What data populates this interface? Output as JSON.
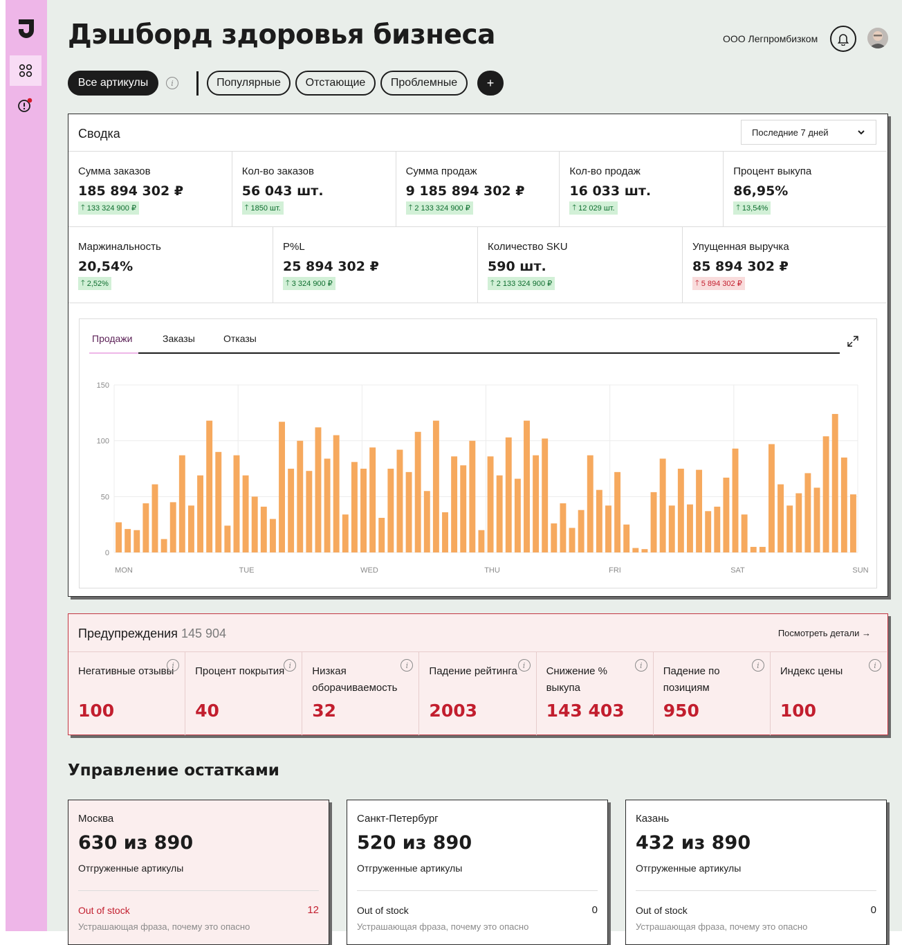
{
  "page_title": "Дэшборд здоровья бизнеса",
  "company_name": "ООО Легпромбизком",
  "filters": [
    {
      "label": "Все артикулы",
      "active": true
    },
    {
      "label": "Популярные",
      "active": false
    },
    {
      "label": "Отстающие",
      "active": false
    },
    {
      "label": "Проблемные",
      "active": false
    }
  ],
  "add_filter_label": "+",
  "summary": {
    "title": "Сводка",
    "period_selected": "Последние 7 дней",
    "row1": [
      {
        "label": "Сумма заказов",
        "value": "185 894 302 ₽",
        "delta": "133 324 900 ₽",
        "trend": "up"
      },
      {
        "label": "Кол-во заказов",
        "value": "56 043 шт.",
        "delta": "1850 шт.",
        "trend": "up"
      },
      {
        "label": "Сумма продаж",
        "value": "9 185 894 302 ₽",
        "delta": "2 133 324 900 ₽",
        "trend": "up"
      },
      {
        "label": "Кол-во продаж",
        "value": "16 033 шт.",
        "delta": "12 029 шт.",
        "trend": "up"
      },
      {
        "label": "Процент выкупа",
        "value": "86,95%",
        "delta": "13,54%",
        "trend": "up"
      }
    ],
    "row2": [
      {
        "label": "Маржинальность",
        "value": "20,54%",
        "delta": "2,52%",
        "trend": "up"
      },
      {
        "label": "P%L",
        "value": "25 894 302 ₽",
        "delta": "3 324 900 ₽",
        "trend": "up"
      },
      {
        "label": "Количество SKU",
        "value": "590 шт.",
        "delta": "2 133 324 900 ₽",
        "trend": "up"
      },
      {
        "label": "Упущенная выручка",
        "value": "85 894 302 ₽",
        "delta": "5 894 302 ₽",
        "trend": "down"
      }
    ]
  },
  "chart_tabs": [
    {
      "label": "Продажи",
      "active": true
    },
    {
      "label": "Заказы",
      "active": false
    },
    {
      "label": "Отказы",
      "active": false
    }
  ],
  "chart_data": {
    "type": "bar",
    "title": "",
    "xlabel": "",
    "ylabel": "",
    "ylim": [
      0,
      150
    ],
    "y_ticks": [
      0,
      50,
      100,
      150
    ],
    "x_day_labels": [
      "MON",
      "TUE",
      "WED",
      "THU",
      "FRI",
      "SAT",
      "SUN"
    ],
    "bar_color": "#f6a95e",
    "grid": true,
    "values": [
      27,
      21,
      20,
      44,
      61,
      12,
      45,
      87,
      42,
      69,
      118,
      90,
      24,
      87,
      69,
      50,
      41,
      30,
      117,
      75,
      100,
      73,
      112,
      84,
      105,
      34,
      81,
      75,
      94,
      31,
      75,
      92,
      72,
      108,
      55,
      118,
      36,
      86,
      78,
      100,
      20,
      86,
      69,
      103,
      66,
      118,
      87,
      102,
      26,
      44,
      22,
      38,
      87,
      56,
      42,
      72,
      25,
      4,
      3,
      54,
      84,
      42,
      75,
      43,
      74,
      37,
      41,
      67,
      93,
      34,
      5,
      5,
      97,
      61,
      42,
      53,
      71,
      58,
      104,
      124,
      85,
      52
    ]
  },
  "alerts": {
    "title": "Предупреждения",
    "count": "145 904",
    "details_link": "Посмотреть детали →",
    "items": [
      {
        "label": "Негативные отзывы",
        "value": "100"
      },
      {
        "label": "Процент покрытия",
        "value": "40"
      },
      {
        "label": "Низкая оборачиваемость",
        "value": "32"
      },
      {
        "label": "Падение рейтинга",
        "value": "2003"
      },
      {
        "label": "Снижение % выкупа",
        "value": "143 403"
      },
      {
        "label": "Падение по позициям",
        "value": "950"
      },
      {
        "label": "Индекс цены",
        "value": "100"
      }
    ]
  },
  "stock": {
    "title": "Управление остатками",
    "warehouses": [
      {
        "city": "Москва",
        "value": "630 из 890",
        "sub": "Отгруженные артикулы",
        "oos_label": "Out of stock",
        "oos_count": "12",
        "desc": "Устрашающая фраза, почему это опасно",
        "alert": true
      },
      {
        "city": "Санкт-Петербург",
        "value": "520 из 890",
        "sub": "Отгруженные артикулы",
        "oos_label": "Out of stock",
        "oos_count": "0",
        "desc": "Устрашающая фраза, почему это опасно",
        "alert": false
      },
      {
        "city": "Казань",
        "value": "432 из 890",
        "sub": "Отгруженные артикулы",
        "oos_label": "Out of stock",
        "oos_count": "0",
        "desc": "Устрашающая фраза, почему это опасно",
        "alert": false
      }
    ]
  },
  "colors": {
    "accent_pink": "#eeb6e8",
    "positive": "#0d6d2e",
    "negative": "#c21e2e",
    "bar": "#f6a95e"
  }
}
